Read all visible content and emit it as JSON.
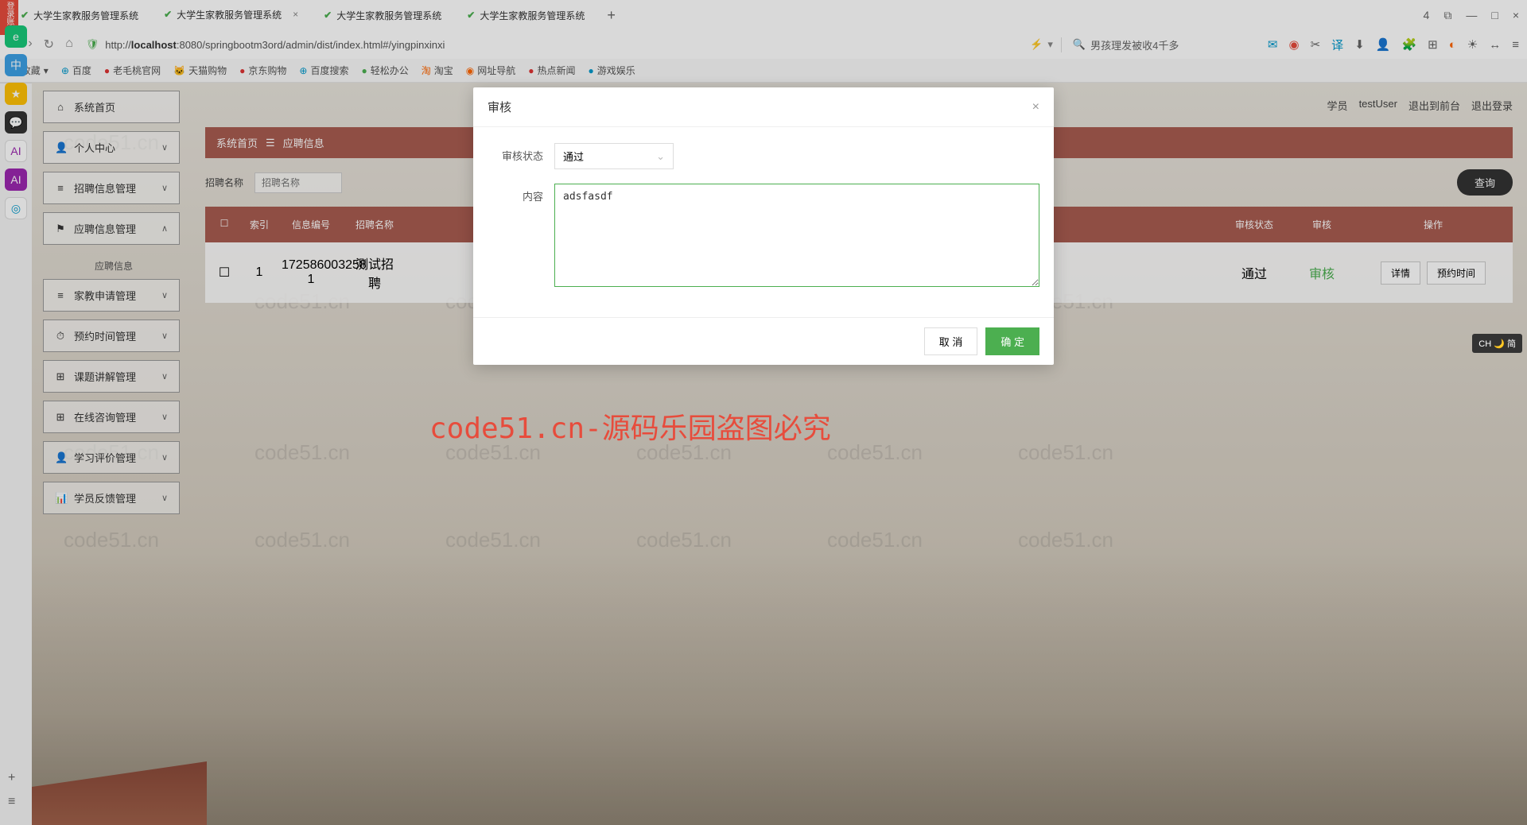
{
  "browser": {
    "tabs": [
      "大学生家教服务管理系统",
      "大学生家教服务管理系统",
      "大学生家教服务管理系统",
      "大学生家教服务管理系统"
    ],
    "new_tab": "+",
    "close": "×",
    "win_num": "4",
    "nav": {
      "back": "‹",
      "forward": "›",
      "reload": "↻",
      "home": "⌂"
    },
    "url_prefix": "http://",
    "url_host": "localhost",
    "url_path": ":8080/springbootm3ord/admin/dist/index.html#/yingpinxinxi",
    "search_placeholder": "男孩理发被收4千多",
    "bookmarks": [
      "收藏",
      "百度",
      "老毛桃官网",
      "天猫购物",
      "京东购物",
      "百度搜索",
      "轻松办公",
      "淘宝",
      "网址导航",
      "热点新闻",
      "游戏娱乐"
    ]
  },
  "app": {
    "title": "大学生家教服务管理系统",
    "user_role": "学员",
    "user_name": "testUser",
    "logout_front": "退出到前台",
    "logout": "退出登录",
    "breadcrumb_home": "系统首页",
    "breadcrumb_current": "应聘信息"
  },
  "sidebar": {
    "items": [
      "系统首页",
      "个人中心",
      "招聘信息管理",
      "应聘信息管理",
      "家教申请管理",
      "预约时间管理",
      "课题讲解管理",
      "在线咨询管理",
      "学习评价管理",
      "学员反馈管理"
    ],
    "sub_item": "应聘信息"
  },
  "filters": {
    "label1": "招聘名称",
    "placeholder1": "招聘名称",
    "search_btn": "查询"
  },
  "table": {
    "headers": {
      "idx": "索引",
      "num": "信息编号",
      "name": "招聘名称",
      "status": "审核状态",
      "audit": "审核",
      "ops": "操作"
    },
    "row": {
      "idx": "1",
      "num": "172586003258​1",
      "name": "测试招聘",
      "status": "通过",
      "audit": "审核",
      "detail": "详情",
      "book": "预约时间"
    }
  },
  "modal": {
    "title": "审核",
    "status_label": "审核状态",
    "status_value": "通过",
    "content_label": "内容",
    "content_value": "adsfasdf",
    "cancel": "取 消",
    "confirm": "确 定"
  },
  "watermark": "code51.cn",
  "watermark_red": "code51.cn-源码乐园盗图必究",
  "side_badge": "CH 🌙 简"
}
